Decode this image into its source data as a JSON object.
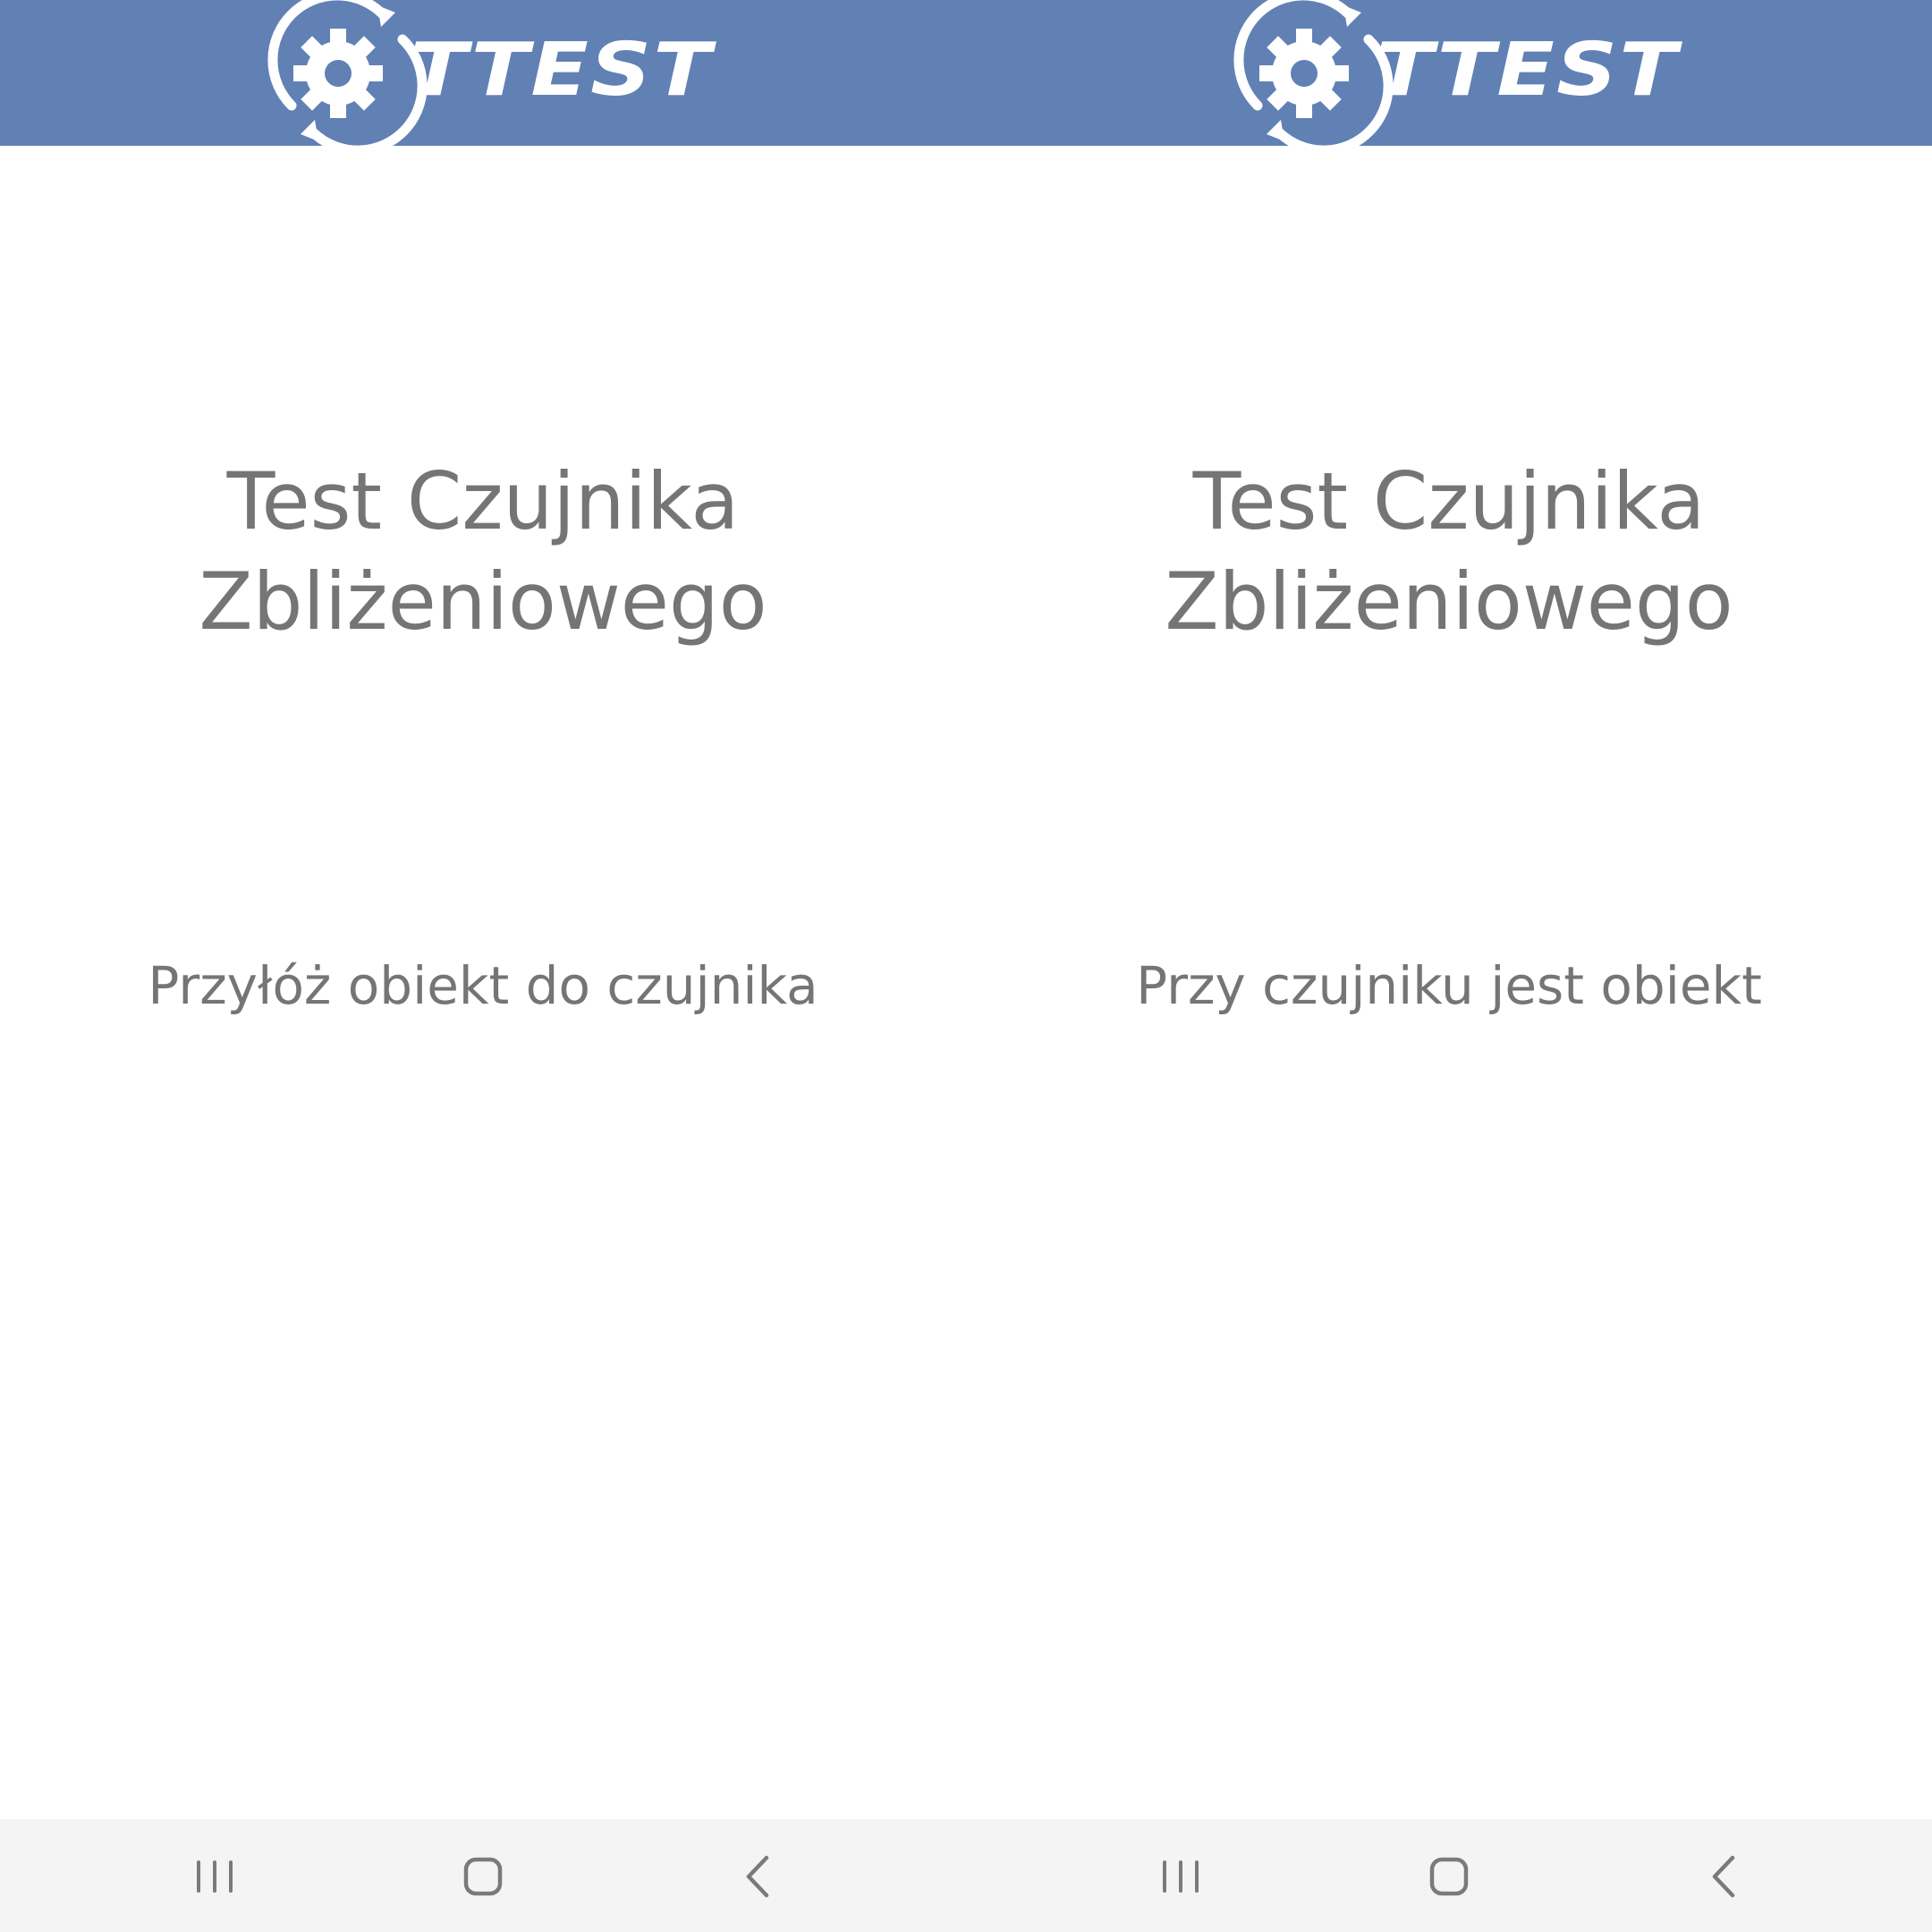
{
  "colors": {
    "header_background": "#6181b5",
    "text": "#757575",
    "navbar_background": "#f4f4f4"
  },
  "screens": [
    {
      "logo": {
        "icon": "gear-refresh-icon",
        "text": "TTEST"
      },
      "title_line1": "Test Czujnika",
      "title_line2": "Zbliżeniowego",
      "status": "Przyłóż obiekt do czujnika",
      "navbar": {
        "recents_icon": "recents-icon",
        "home_icon": "home-icon",
        "back_icon": "back-icon"
      }
    },
    {
      "logo": {
        "icon": "gear-refresh-icon",
        "text": "TTEST"
      },
      "title_line1": "Test Czujnika",
      "title_line2": "Zbliżeniowego",
      "status": "Przy czujniku jest obiekt",
      "navbar": {
        "recents_icon": "recents-icon",
        "home_icon": "home-icon",
        "back_icon": "back-icon"
      }
    }
  ]
}
